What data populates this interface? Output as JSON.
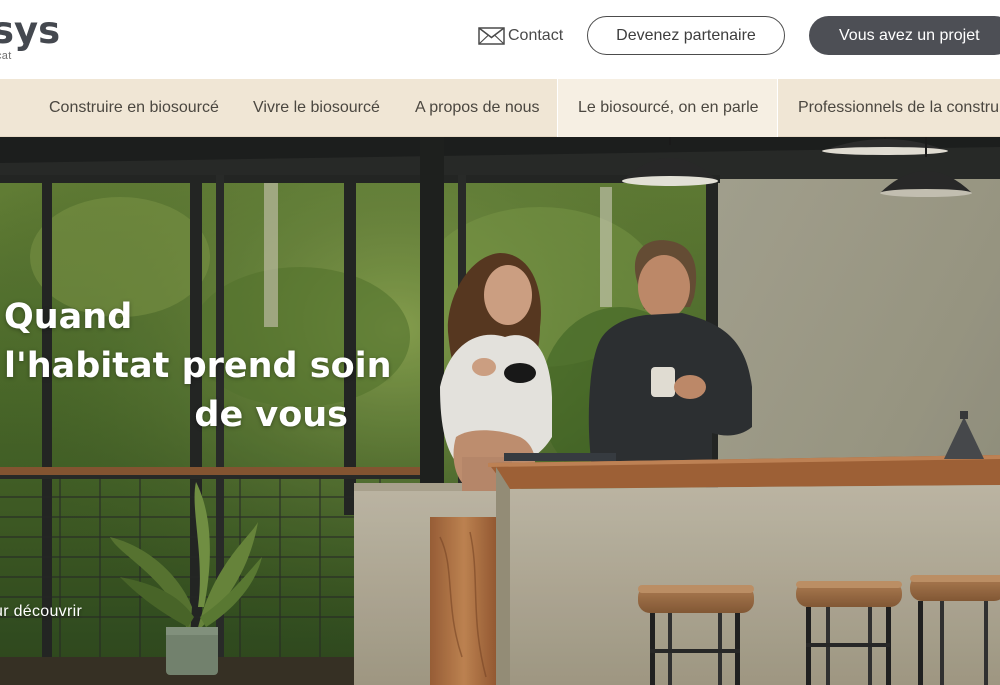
{
  "header": {
    "logo_text": "sys",
    "logo_subtext": "cat",
    "contact_label": "Contact",
    "partner_button": "Devenez partenaire",
    "project_button": "Vous avez un projet"
  },
  "nav": {
    "items": [
      {
        "label": "Construire en biosourcé"
      },
      {
        "label": "Vivre le biosourcé"
      },
      {
        "label": "A propos de nous"
      },
      {
        "label": "Le biosourcé, on en parle"
      },
      {
        "label": "Professionnels de la constru"
      }
    ]
  },
  "hero": {
    "title_line1": "Quand",
    "title_line2": "l'habitat prend soin",
    "title_line3": "de vous",
    "discover_link": "ur découvrir"
  },
  "colors": {
    "nav_bg": "#f0e6d5",
    "nav_active_bg": "#f6efe3",
    "primary_button": "#4d4f55",
    "text": "#4b4740"
  },
  "icons": {
    "contact": "envelope-icon"
  }
}
